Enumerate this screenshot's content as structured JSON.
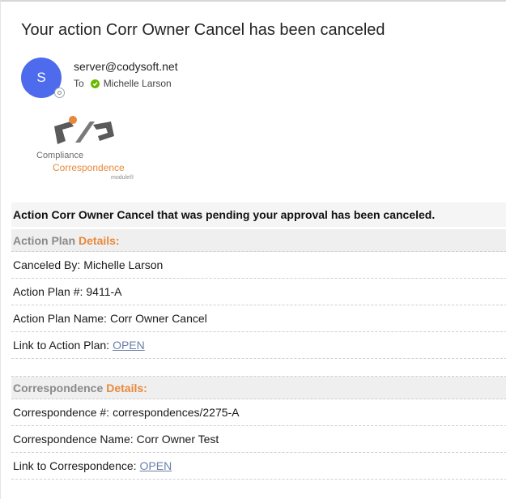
{
  "email": {
    "subject": "Your action Corr Owner Cancel has been canceled",
    "sender": {
      "avatar_initial": "S",
      "address": "server@codysoft.net"
    },
    "to_label": "To",
    "recipient": "Michelle Larson"
  },
  "logo": {
    "line1": "Compliance",
    "line2": "Correspondence",
    "line3": "module®",
    "colors": {
      "dark": "#5a5a5a",
      "orange": "#e8893a"
    }
  },
  "body": {
    "banner": "Action Corr Owner Cancel that was pending your approval has been canceled.",
    "action_plan": {
      "heading": "Action Plan",
      "heading_accent": "Details:",
      "rows": [
        {
          "label": "Canceled By:",
          "value": "Michelle Larson"
        },
        {
          "label": "Action Plan #:",
          "value": "9411-A"
        },
        {
          "label": "Action Plan Name:",
          "value": "Corr Owner Cancel"
        }
      ],
      "link_label": "Link to Action Plan:",
      "link_text": "OPEN"
    },
    "correspondence": {
      "heading": "Correspondence",
      "heading_accent": "Details:",
      "rows": [
        {
          "label": "Correspondence #:",
          "value": "correspondences/2275-A"
        },
        {
          "label": "Correspondence Name:",
          "value": "Corr Owner Test"
        }
      ],
      "link_label": "Link to Correspondence:",
      "link_text": "OPEN"
    }
  },
  "colors": {
    "avatar": "#4f6bed",
    "accent": "#e8893a",
    "link": "#6b7fa8",
    "status_ok": "#6bb700"
  },
  "icons": {
    "recipient_status": "check-circle-icon",
    "avatar_presence": "presence-icon"
  }
}
